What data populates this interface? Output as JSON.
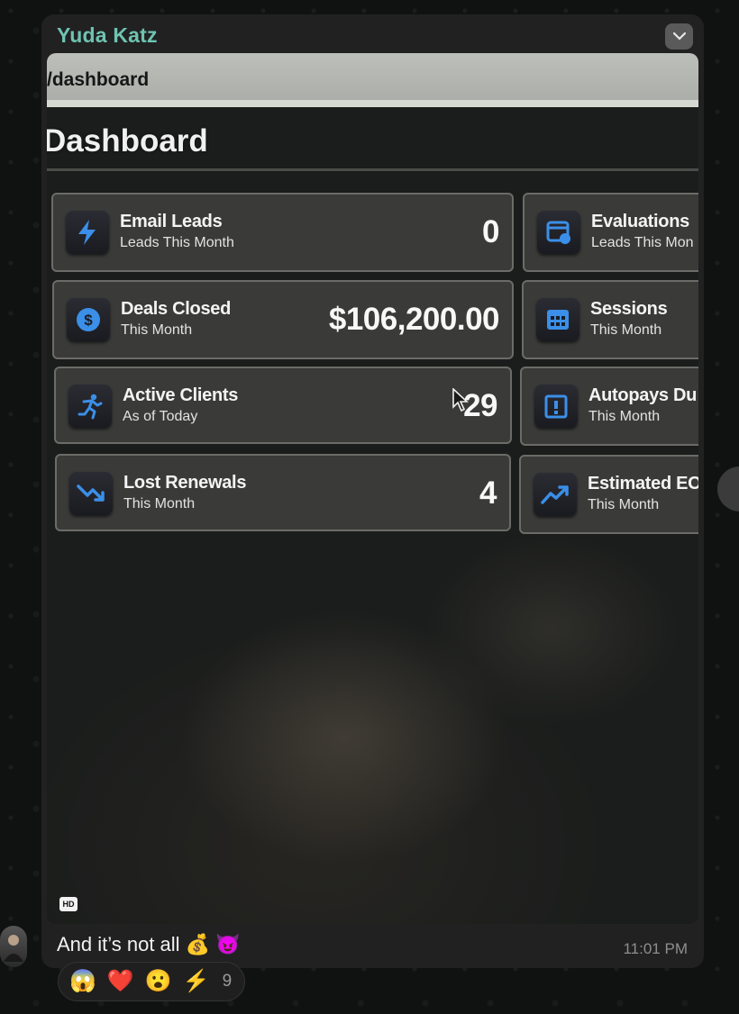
{
  "chat": {
    "sender_name": "Yuda Katz",
    "message_text": "And it’s not all",
    "message_emojis": "💰 😈",
    "time": "11:01 PM",
    "hd_badge": "HD"
  },
  "photo": {
    "url_path": "/dashboard",
    "page_title": "Dashboard",
    "cards": [
      {
        "title": "Email Leads",
        "subtitle": "Leads This Month",
        "value": "0",
        "icon": "lightning-icon"
      },
      {
        "title": "Evaluations",
        "subtitle": "Leads This Mon",
        "value": "",
        "icon": "evaluation-icon"
      },
      {
        "title": "Deals Closed",
        "subtitle": "This Month",
        "value": "$106,200.00",
        "icon": "dollar-icon"
      },
      {
        "title": "Sessions",
        "subtitle": "This Month",
        "value": "",
        "icon": "calendar-icon"
      },
      {
        "title": "Active Clients",
        "subtitle": "As of Today",
        "value": "29",
        "icon": "runner-icon"
      },
      {
        "title": "Autopays Du",
        "subtitle": "This Month",
        "value": "",
        "icon": "alert-calendar-icon"
      },
      {
        "title": "Lost Renewals",
        "subtitle": "This Month",
        "value": "4",
        "icon": "trend-down-icon"
      },
      {
        "title": "Estimated EO",
        "subtitle": "This Month",
        "value": "",
        "icon": "trend-up-icon"
      }
    ]
  },
  "reactions": {
    "items": [
      "😱",
      "❤️",
      "😮",
      "⚡"
    ],
    "count": "9"
  },
  "colors": {
    "sender": "#6fc3b2",
    "bubble": "#212121",
    "icon_accent": "#3b8fe8"
  }
}
